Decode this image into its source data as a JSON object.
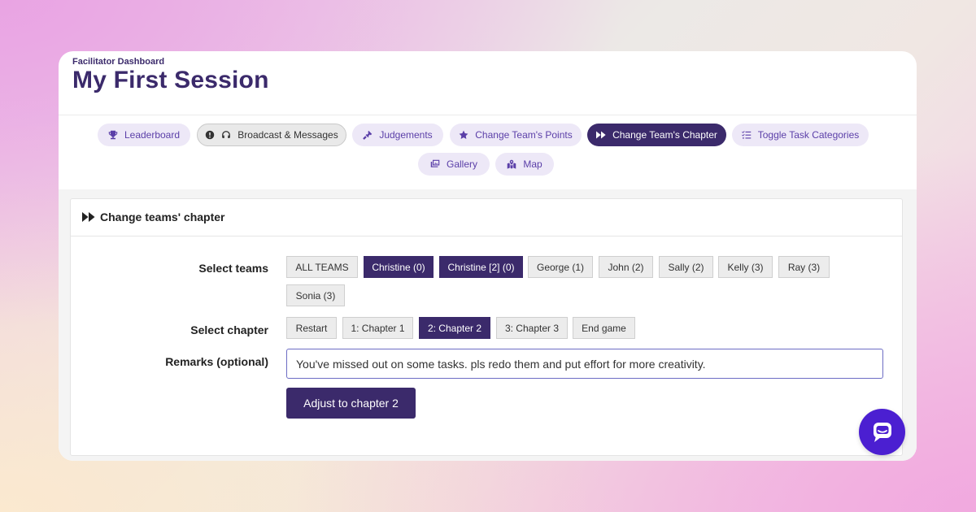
{
  "header": {
    "subtitle": "Facilitator Dashboard",
    "title": "My First Session"
  },
  "nav": {
    "items": [
      {
        "label": "Leaderboard",
        "icon": "trophy-icon"
      },
      {
        "label": "Broadcast & Messages",
        "icon": "info-headset-icon"
      },
      {
        "label": "Judgements",
        "icon": "gavel-icon"
      },
      {
        "label": "Change Team's Points",
        "icon": "star-icon"
      },
      {
        "label": "Change Team's Chapter",
        "icon": "fast-forward-icon",
        "active": true
      },
      {
        "label": "Toggle Task Categories",
        "icon": "checklist-icon"
      },
      {
        "label": "Gallery",
        "icon": "images-icon"
      },
      {
        "label": "Map",
        "icon": "map-icon"
      }
    ]
  },
  "panel": {
    "title": "Change teams' chapter",
    "select_teams_label": "Select teams",
    "teams": [
      {
        "label": "ALL TEAMS",
        "selected": false
      },
      {
        "label": "Christine (0)",
        "selected": true
      },
      {
        "label": "Christine [2] (0)",
        "selected": true
      },
      {
        "label": "George (1)",
        "selected": false
      },
      {
        "label": "John (2)",
        "selected": false
      },
      {
        "label": "Sally (2)",
        "selected": false
      },
      {
        "label": "Kelly (3)",
        "selected": false
      },
      {
        "label": "Ray (3)",
        "selected": false
      },
      {
        "label": "Sonia (3)",
        "selected": false
      }
    ],
    "select_chapter_label": "Select chapter",
    "chapters": [
      {
        "label": "Restart",
        "selected": false
      },
      {
        "label": "1: Chapter 1",
        "selected": false
      },
      {
        "label": "2: Chapter 2",
        "selected": true
      },
      {
        "label": "3: Chapter 3",
        "selected": false
      },
      {
        "label": "End game",
        "selected": false
      }
    ],
    "remarks_label": "Remarks (optional)",
    "remarks_value": "You've missed out on some tasks. pls redo them and put effort for more creativity.",
    "submit_label": "Adjust to chapter 2"
  },
  "chat": {
    "icon": "chat-bubble-icon"
  },
  "colors": {
    "primary": "#3b2a6b",
    "pill_bg": "#ede8f7",
    "chat_fab": "#4b1fd1"
  }
}
